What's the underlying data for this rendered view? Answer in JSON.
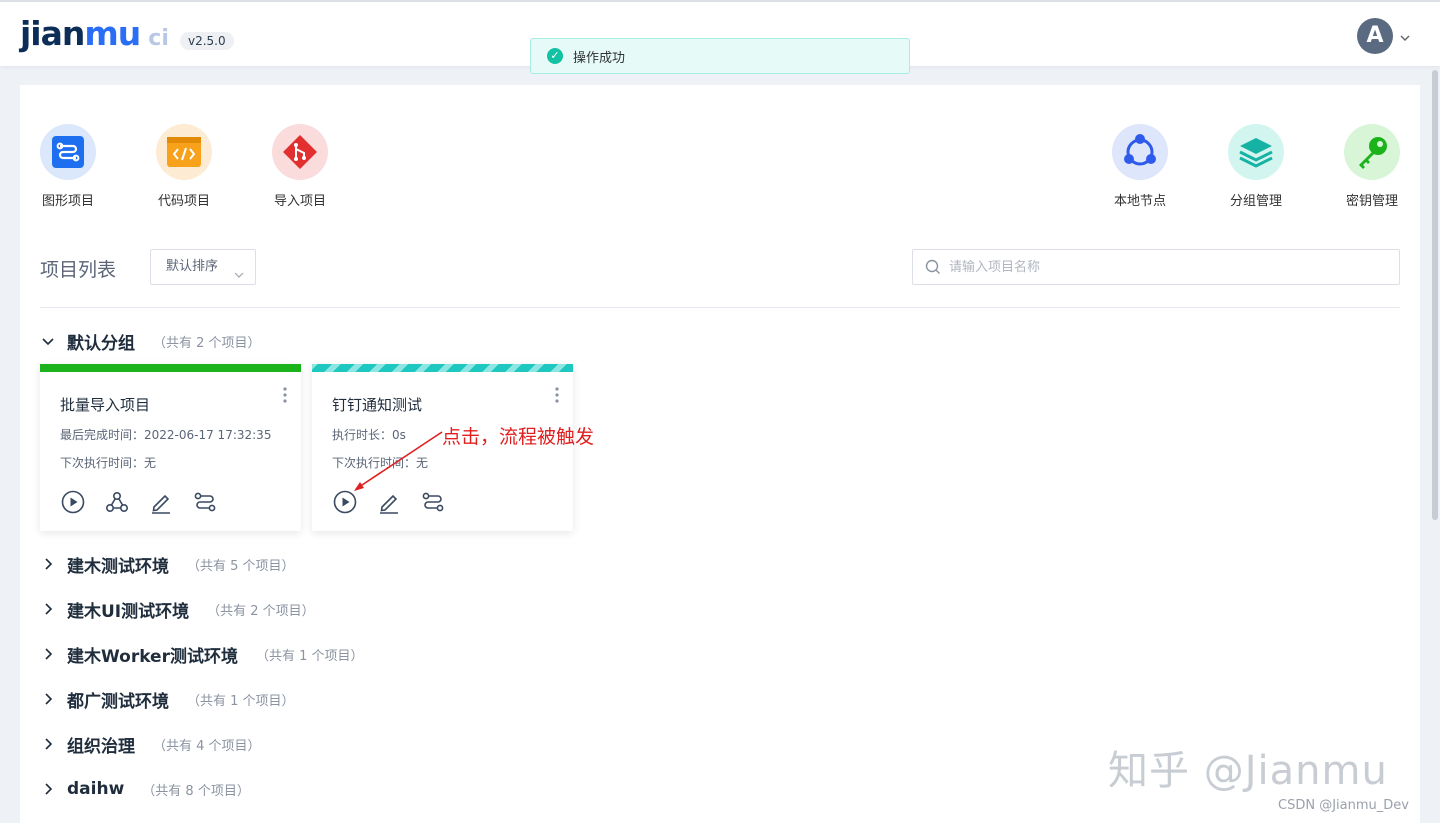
{
  "header": {
    "logo_main": "jian",
    "logo_mu": "mu",
    "logo_ci": "ci",
    "version": "v2.5.0",
    "toast": "操作成功",
    "avatar_letter": "A"
  },
  "quick_actions_left": [
    {
      "label": "图形项目",
      "icon": "graph-project-icon",
      "color": "#1e6ff0",
      "bg": "#dbe8fb"
    },
    {
      "label": "代码项目",
      "icon": "code-project-icon",
      "color": "#f7a21a",
      "bg": "#fdebd3"
    },
    {
      "label": "导入项目",
      "icon": "git-import-icon",
      "color": "#e23030",
      "bg": "#fadcdc"
    }
  ],
  "quick_actions_right": [
    {
      "label": "本地节点",
      "icon": "local-node-icon",
      "color": "#2f5bea",
      "bg": "#dde6fb"
    },
    {
      "label": "分组管理",
      "icon": "group-manage-icon",
      "color": "#16b3a4",
      "bg": "#d3f5ef"
    },
    {
      "label": "密钥管理",
      "icon": "key-manage-icon",
      "color": "#1bb21b",
      "bg": "#d8f5d8"
    }
  ],
  "list": {
    "title": "项目列表",
    "sort_label": "默认排序",
    "search_placeholder": "请输入项目名称"
  },
  "groups": [
    {
      "name": "默认分组",
      "count": "（共有 2 个项目）",
      "expanded": true
    },
    {
      "name": "建木测试环境",
      "count": "（共有 5 个项目）",
      "expanded": false
    },
    {
      "name": "建木UI测试环境",
      "count": "（共有 2 个项目）",
      "expanded": false
    },
    {
      "name": "建木Worker测试环境",
      "count": "（共有 1 个项目）",
      "expanded": false
    },
    {
      "name": "都广测试环境",
      "count": "（共有 1 个项目）",
      "expanded": false
    },
    {
      "name": "组织治理",
      "count": "（共有 4 个项目）",
      "expanded": false
    },
    {
      "name": "daihw",
      "count": "（共有 8 个项目）",
      "expanded": false
    }
  ],
  "cards": [
    {
      "title": "批量导入项目",
      "line1": "最后完成时间：2022-06-17 17:32:35",
      "line2": "下次执行时间：无",
      "status_color": "#1bb21b",
      "actions": [
        "play-icon",
        "webhook-icon",
        "edit-icon",
        "workflow-icon"
      ]
    },
    {
      "title": "钉钉通知测试",
      "line1": "执行时长：0s",
      "line2": "下次执行时间：无",
      "status_color": "#1ec7c0",
      "actions": [
        "play-icon",
        "edit-icon",
        "workflow-icon"
      ]
    }
  ],
  "annotation": "点击，流程被触发",
  "watermark": "知乎 @Jianmu",
  "csdn": "CSDN @Jianmu_Dev"
}
